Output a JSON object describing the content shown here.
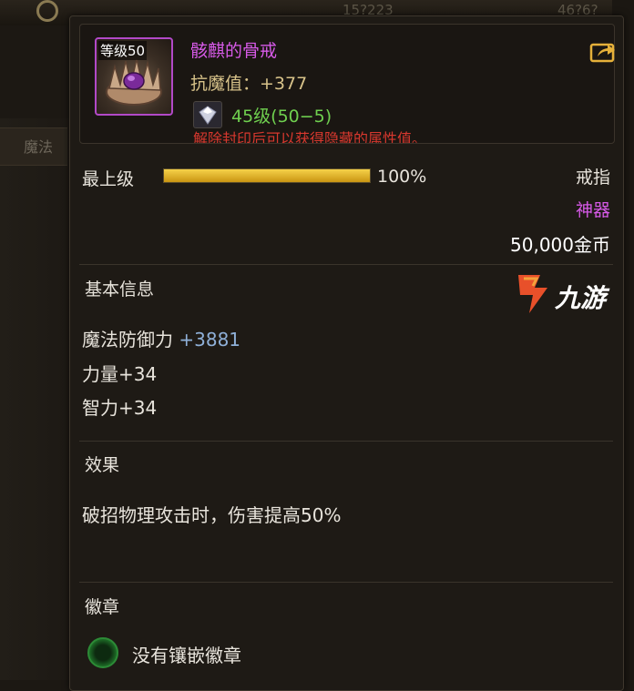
{
  "background": {
    "left_tab_label": "魔法",
    "top_values": [
      "15?223",
      "46?6?"
    ]
  },
  "item": {
    "level_badge": "等级50",
    "name": "骸麒的骨戒",
    "stat_line": "抗魔值：+377",
    "gem_level": "45级(50−5)",
    "seal_hint": "解除封印后可以获得隐藏的属性值。",
    "rank_label": "最上级",
    "rank_progress_percent": 100,
    "rank_progress_text": "100%",
    "type": "戒指",
    "rarity": "神器",
    "price": "50,000金币"
  },
  "sections": {
    "basic_info_title": "基本信息",
    "stats": [
      {
        "name": "魔法防御力",
        "value": "+3881"
      },
      {
        "name": "力量",
        "value": "+34"
      },
      {
        "name": "智力",
        "value": "+34"
      }
    ],
    "effect_title": "效果",
    "effect_text": "破招物理攻击时，伤害提高50%",
    "emblem_title": "徽章",
    "emblem_status": "没有镶嵌徽章"
  },
  "watermark": {
    "text": "九游"
  },
  "colors": {
    "epic_purple": "#d75ae8",
    "gold_stat": "#d8c38a",
    "gem_green": "#6fcf4f",
    "seal_red": "#d8382e",
    "bonus_blue": "#8fb0d8",
    "progress_gold": "#f6d24a"
  },
  "icons": {
    "share": "share-icon",
    "gem": "diamond-gem-icon",
    "item": "bone-ring-icon",
    "emblem_slot": "empty-emblem-slot-icon"
  }
}
